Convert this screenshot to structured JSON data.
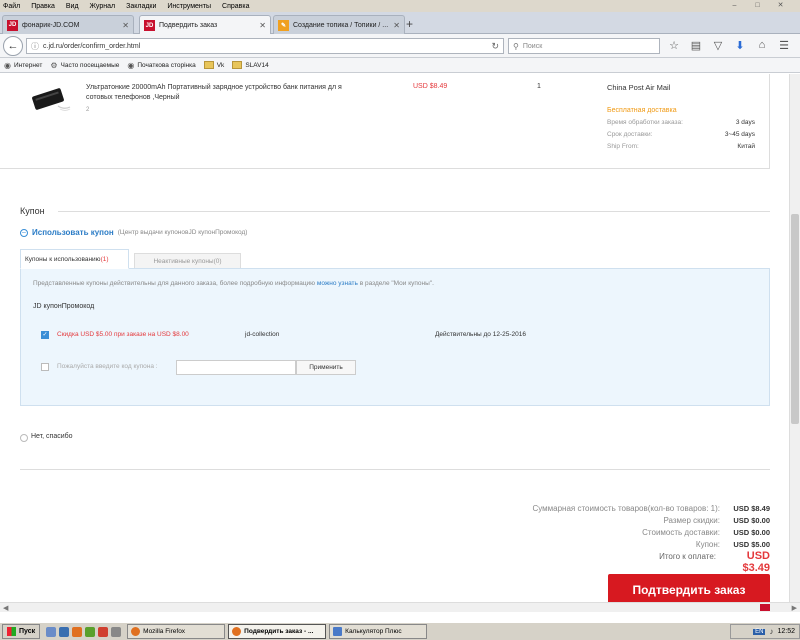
{
  "menu": [
    "Файл",
    "Правка",
    "Вид",
    "Журнал",
    "Закладки",
    "Инструменты",
    "Справка"
  ],
  "tabs": [
    {
      "icon": "JD",
      "label": "фонарик-JD.COM",
      "active": false
    },
    {
      "icon": "JD",
      "label": "Подвердить заказ",
      "active": true
    },
    {
      "icon": "pencil",
      "label": "Создание топика / Топики / ...",
      "active": false
    }
  ],
  "nav": {
    "url": "c.jd.ru/order/confirm_order.html",
    "search_placeholder": "Поиск"
  },
  "bookmarks": [
    "Интернет",
    "Часто посещаемые",
    "Початкова сторінка",
    "Vk",
    "SLAV14"
  ],
  "product": {
    "name": "Ультратонкие 20000mAh Портативный зарядное устройство банк питания дл я сотовых телефонов ,Черный",
    "extra": "2",
    "price": "USD $8.49",
    "qty": "1",
    "shipping": {
      "method": "China Post Air Mail",
      "free": "Бесплатная доставка",
      "rows": [
        {
          "k": "Время обработки заказа:",
          "v": "3 days"
        },
        {
          "k": "Срок доставки:",
          "v": "3~45 days"
        },
        {
          "k": "Ship From:",
          "v": "Китай"
        }
      ]
    }
  },
  "coupon": {
    "title": "Купон",
    "use_label": "Использовать купон",
    "use_sub": "(Центр выдачи купоновJD купонПромокод)",
    "tab_available": "Купоны к использованию",
    "tab_available_count": "(1)",
    "tab_inactive": "Неактивные купоны(0)",
    "info_before": "Представленные купоны действительны для данного заказа, более подробную информацию ",
    "info_link": "можно узнать",
    "info_after": " в разделе \"Мои купоны\".",
    "jd_label": "JD купонПромокод",
    "item": {
      "desc": "Скидка USD $5.00 при заказе на USD $8.00",
      "source": "jd-collection",
      "valid": "Действительны до 12-25-2016"
    },
    "code_label": "Пожалуйста введите код купона :",
    "apply": "Применить",
    "no_thanks": "Нет, спасибо"
  },
  "summary": {
    "rows": [
      {
        "k": "Суммарная стоимость товаров(кол-во товаров: 1):",
        "v": "USD $8.49"
      },
      {
        "k": "Размер скидки:",
        "v": "USD $0.00"
      },
      {
        "k": "Стоимость доставки:",
        "v": "USD $0.00"
      },
      {
        "k": "Купон:",
        "v": "USD $5.00"
      }
    ],
    "total_label": "Итого к оплате:",
    "total_value": "USD $3.49",
    "confirm": "Подтвердить заказ"
  },
  "taskbar": {
    "start": "Пуск",
    "windows": [
      "Mozilla Firefox",
      "Подвердить заказ - ...",
      "Калькулятор Плюс"
    ],
    "lang": "EN",
    "clock": "12:52"
  },
  "colors": {
    "accent_red": "#d71920",
    "price_red": "#e4393c",
    "link_blue": "#2b7cc6",
    "free_ship": "#f09a14"
  }
}
